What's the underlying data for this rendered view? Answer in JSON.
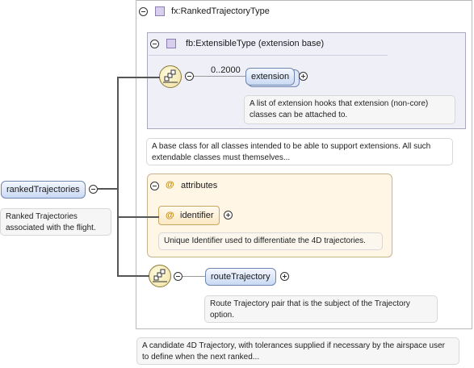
{
  "root_element": {
    "name": "rankedTrajectories",
    "note": "Ranked Trajectories associated with the flight."
  },
  "complex_type": {
    "name": "fx:RankedTrajectoryType",
    "note": "A candidate 4D Trajectory, with tolerances supplied if necessary by the airspace user to define when the next ranked..."
  },
  "extension_base": {
    "name": "fb:ExtensibleType (extension base)",
    "note": "A base class for all classes intended to be able to support extensions. All such extendable classes must themselves...",
    "cardinality": "0..2000",
    "element": {
      "name": "extension",
      "note": "A list of extension hooks that extension (non-core) classes can be attached to."
    }
  },
  "attributes": {
    "title": "attributes",
    "items": [
      {
        "name": "identifier",
        "note": "Unique Identifier used to differentiate the 4D trajectories."
      }
    ]
  },
  "route_trajectory": {
    "name": "routeTrajectory",
    "note": "Route Trajectory pair that is the subject of the Trajectory option."
  }
}
